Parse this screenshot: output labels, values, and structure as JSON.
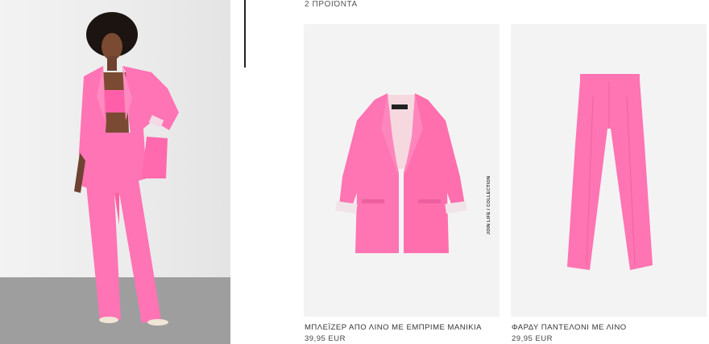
{
  "results": {
    "count_label": "2 ΠΡΟΙΌΝΤΑ"
  },
  "products": [
    {
      "name": "ΜΠΛΕΪΖΕΡ ΑΠΟ ΛΙΝΟ ΜΕ ΕΜΠΡΙΜΕ ΜΑΝΙΚΙΑ",
      "price": "39,95 EUR",
      "image_tag": "JOIN LIFE / COLLECTION",
      "color": "#ff7ab3"
    },
    {
      "name": "ΦΑΡΔΥ ΠΑΝΤΕΛΟΝΙ ΜΕ ΛΙΝΟ",
      "price": "29,95 EUR",
      "color": "#ff7ab3"
    }
  ],
  "colors": {
    "accent_pink": "#ff6fae",
    "background": "#ffffff",
    "text": "#333333"
  }
}
